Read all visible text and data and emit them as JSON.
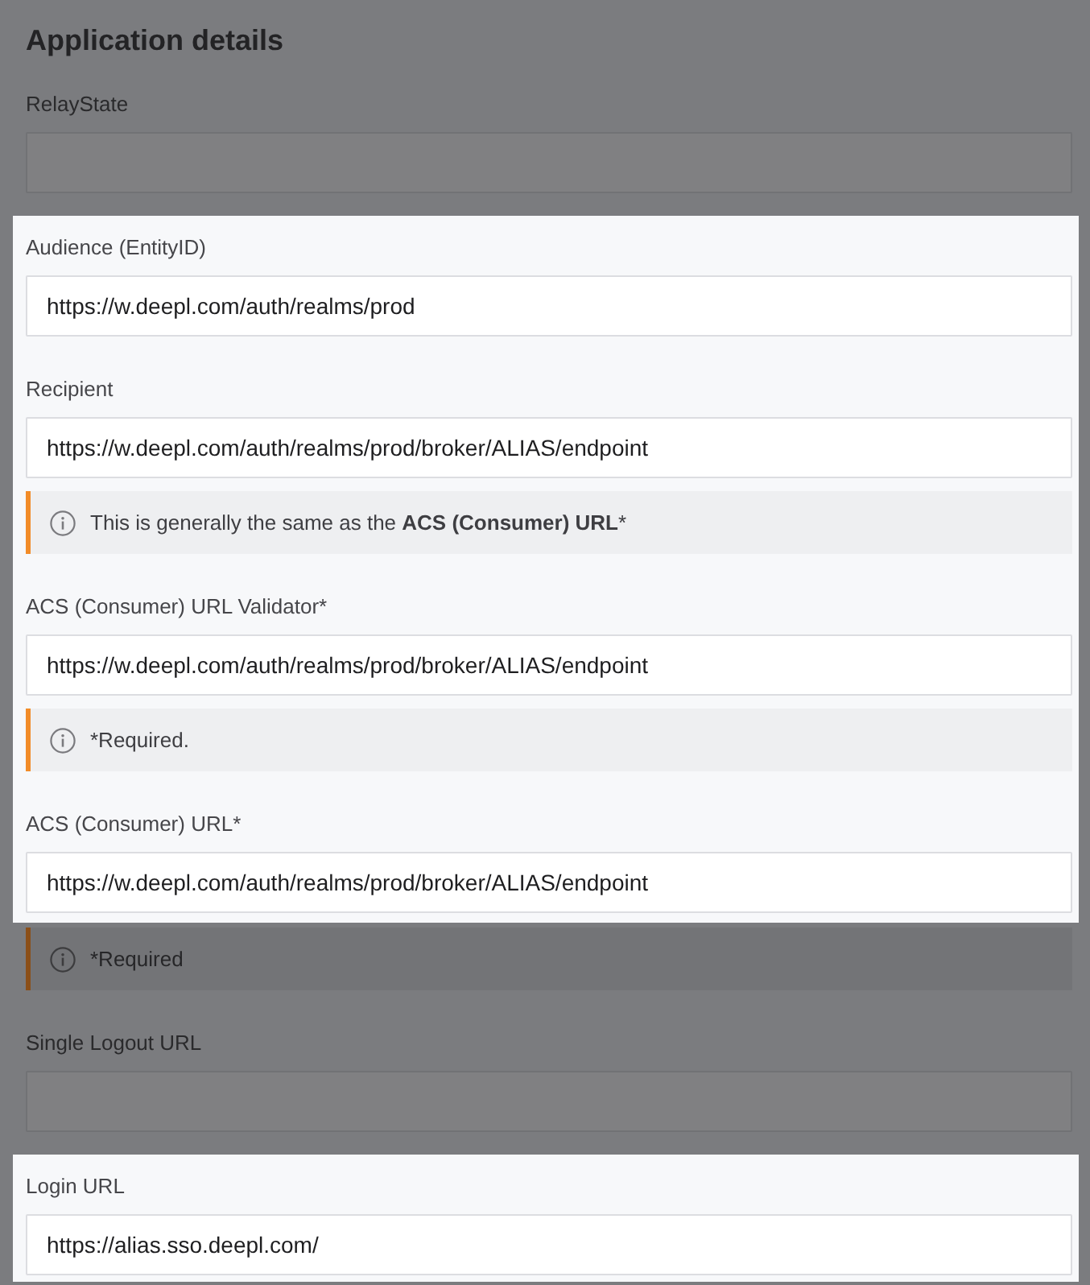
{
  "sections": [
    {
      "highlighted": false,
      "items": [
        {
          "kind": "heading",
          "text": "Application details"
        },
        {
          "kind": "field",
          "label": "RelayState"
        }
      ]
    },
    {
      "highlighted": true,
      "items": [
        {
          "kind": "field",
          "label": "Audience (EntityID)",
          "value": "https://w.deepl.com/auth/realms/prod"
        },
        {
          "kind": "field",
          "label": "Recipient",
          "value": "https://w.deepl.com/auth/realms/prod/broker/ALIAS/endpoint"
        },
        {
          "kind": "note",
          "text": "This is generally the same as the **ACS (Consumer) URL***"
        },
        {
          "kind": "field",
          "label": "ACS (Consumer) URL Validator*",
          "value": "https://w.deepl.com/auth/realms/prod/broker/ALIAS/endpoint"
        },
        {
          "kind": "note",
          "text": "*Required."
        },
        {
          "kind": "field",
          "label": "ACS (Consumer) URL*",
          "value": "https://w.deepl.com/auth/realms/prod/broker/ALIAS/endpoint"
        }
      ]
    },
    {
      "highlighted": false,
      "items": [
        {
          "kind": "note",
          "text": "*Required"
        },
        {
          "kind": "field",
          "label": "Single Logout URL"
        }
      ]
    },
    {
      "highlighted": true,
      "items": [
        {
          "kind": "field",
          "label": "Login URL",
          "value": "https://alias.sso.deepl.com/"
        }
      ]
    }
  ]
}
